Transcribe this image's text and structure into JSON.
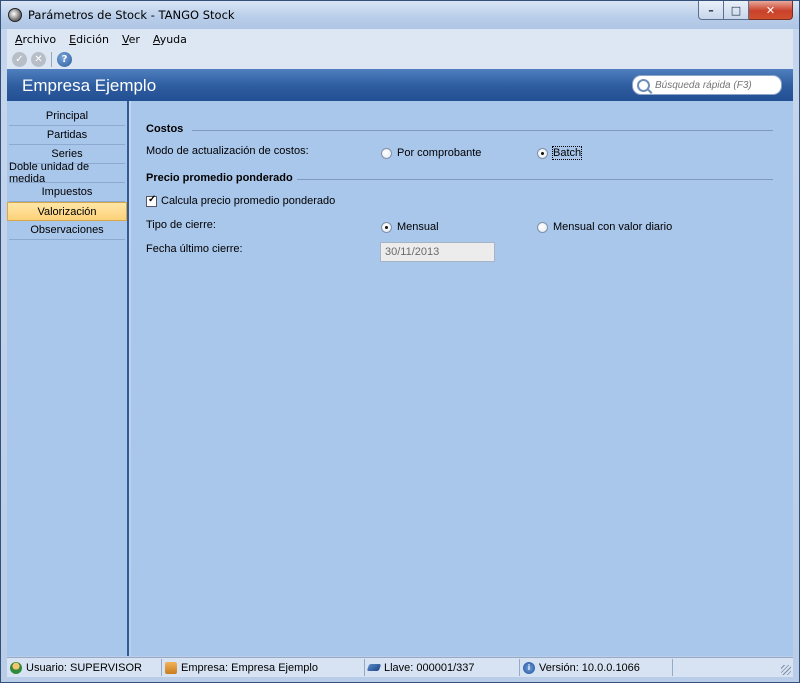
{
  "window": {
    "title": "Parámetros de Stock - TANGO Stock",
    "min": "–",
    "max": "□",
    "close": "✕"
  },
  "menu": {
    "archivo_key": "A",
    "archivo_rest": "rchivo",
    "edicion_key": "E",
    "edicion_rest": "dición",
    "ver_key": "V",
    "ver_rest": "er",
    "ayuda_key": "A",
    "ayuda_rest": "yuda"
  },
  "toolbar": {
    "accept_icon": "check-icon",
    "cancel_icon": "close-icon",
    "help_icon": "help-icon",
    "accept_glyph": "✓",
    "cancel_glyph": "✕",
    "help_glyph": "?"
  },
  "header": {
    "company": "Empresa Ejemplo",
    "search_placeholder": "Búsqueda rápida (F3)"
  },
  "sidebar": {
    "items": [
      {
        "label": "Principal"
      },
      {
        "label": "Partidas"
      },
      {
        "label": "Series"
      },
      {
        "label": "Doble unidad de medida"
      },
      {
        "label": "Impuestos"
      },
      {
        "label": "Valorización",
        "active": true
      },
      {
        "label": "Observaciones"
      }
    ]
  },
  "content": {
    "costos": {
      "title": "Costos",
      "modo_label": "Modo de actualización de costos:",
      "options": [
        {
          "label": "Por comprobante",
          "selected": false
        },
        {
          "label": "Batch",
          "selected": true
        }
      ]
    },
    "ppp": {
      "title": "Precio promedio ponderado",
      "checkbox_label": "Calcula precio promedio ponderado",
      "checkbox_checked": true,
      "tipo_label": "Tipo de cierre:",
      "tipo_options": [
        {
          "label": "Mensual",
          "selected": true
        },
        {
          "label": "Mensual con valor diario",
          "selected": false
        }
      ],
      "fecha_label": "Fecha último cierre:",
      "fecha_value": "30/11/2013"
    }
  },
  "status": {
    "usuario": "Usuario: SUPERVISOR",
    "empresa": "Empresa: Empresa Ejemplo",
    "llave": "Llave: 000001/337",
    "version": "Versión: 10.0.0.1066",
    "info_glyph": "i"
  }
}
